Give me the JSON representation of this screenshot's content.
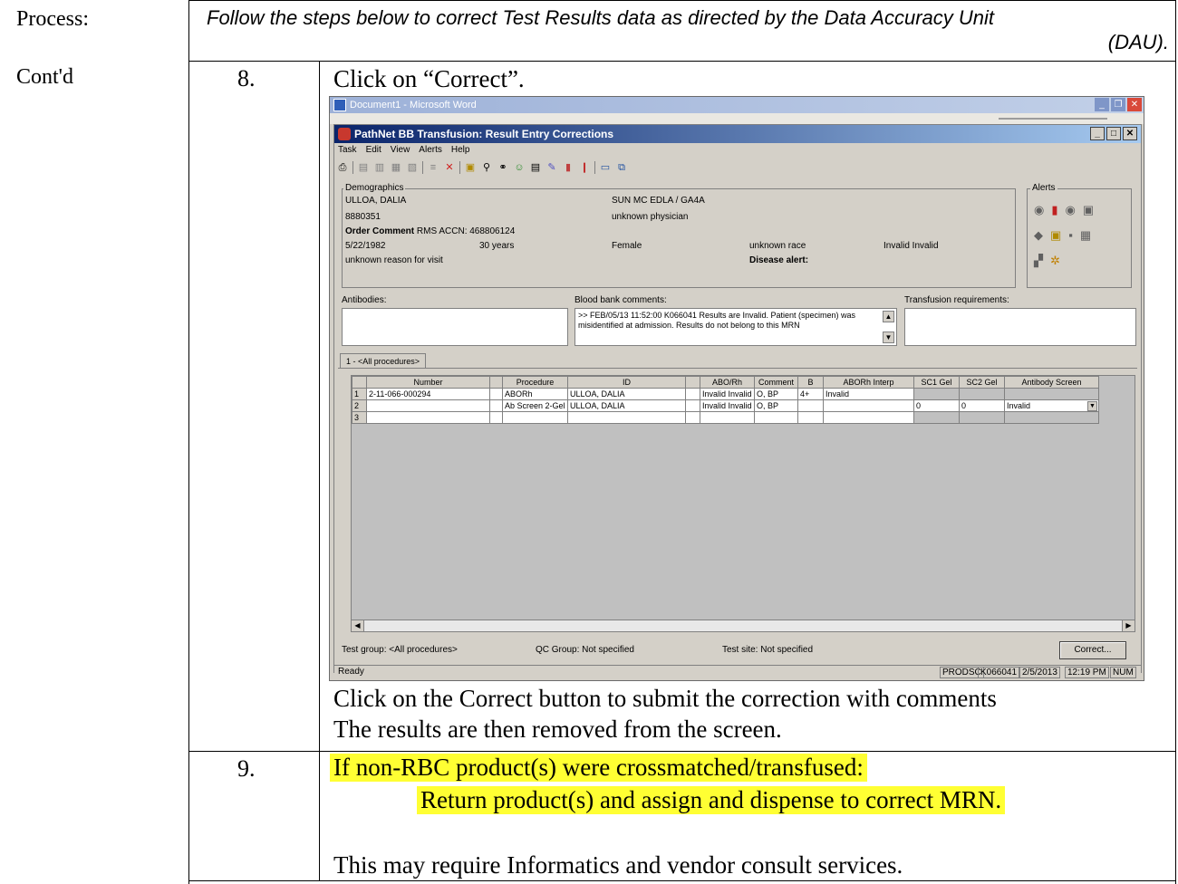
{
  "left_labels": {
    "process": "Process:",
    "contd": "Cont'd"
  },
  "header": {
    "line1": "Follow the steps below to correct Test Results data as directed by the Data Accuracy Unit",
    "line2": "(DAU)."
  },
  "step8": {
    "number": "8.",
    "instruction": "Click on “Correct”.",
    "after_line1": "Click on the Correct button to submit the correction with comments",
    "after_line2": "The results are then removed from the screen."
  },
  "step9": {
    "number": "9.",
    "line1": "If non-RBC product(s) were crossmatched/transfused:",
    "line2": "Return product(s) and assign and dispense to correct MRN.",
    "line3": "This may require Informatics and vendor consult services."
  },
  "screenshot": {
    "outer_title": "Document1 - Microsoft Word",
    "inner_title": "PathNet BB Transfusion: Result Entry Corrections",
    "menu": [
      "Task",
      "Edit",
      "View",
      "Alerts",
      "Help"
    ],
    "demographics": {
      "legend": "Demographics",
      "name": "ULLOA, DALIA",
      "facility": "SUN MC EDLA / GA4A",
      "mrn": "8880351",
      "physician": "unknown physician",
      "order_comment_label": "Order Comment",
      "order_comment_value": "RMS ACCN: 468806124",
      "dob": "5/22/1982",
      "age": "30 years",
      "sex": "Female",
      "race": "unknown race",
      "abo": "Invalid Invalid",
      "reason": "unknown reason for visit",
      "disease_alert": "Disease alert:"
    },
    "alerts_legend": "Alerts",
    "antibodies_label": "Antibodies:",
    "bb_comments_label": "Blood bank comments:",
    "bb_comments_text": ">> FEB/05/13 11:52:00  K066041   Results are Invalid.  Patient (specimen) was misidentified at admission.  Results do not belong to this MRN",
    "transfusion_label": "Transfusion requirements:",
    "tab_label": "1 - <All procedures>",
    "grid": {
      "columns": [
        "Number",
        "Procedure",
        "ID",
        "ABO/Rh",
        "Comment",
        "B",
        "ABORh Interp",
        "SC1 Gel",
        "SC2 Gel",
        "Antibody Screen"
      ],
      "rows": [
        {
          "n": "1",
          "number": "2-11-066-000294",
          "procedure": "ABORh",
          "id": "ULLOA, DALIA",
          "abo": "Invalid Invalid",
          "comment": "O, BP",
          "b": "4+",
          "interp": "Invalid",
          "sc1": "",
          "sc2": "",
          "ab": ""
        },
        {
          "n": "2",
          "number": "",
          "procedure": "Ab Screen 2-Gel",
          "id": "ULLOA, DALIA",
          "abo": "Invalid Invalid",
          "comment": "O, BP",
          "b": "",
          "interp": "",
          "sc1": "0",
          "sc2": "0",
          "ab": "Invalid"
        },
        {
          "n": "3",
          "number": "",
          "procedure": "",
          "id": "",
          "abo": "",
          "comment": "",
          "b": "",
          "interp": "",
          "sc1": "",
          "sc2": "",
          "ab": ""
        }
      ]
    },
    "test_group": "Test group:  <All procedures>",
    "qc_group": "QC Group:  Not specified",
    "test_site": "Test site:  Not specified",
    "correct_button": "Correct...",
    "status": {
      "ready": "Ready",
      "db": "PRODSC",
      "user": "K066041",
      "date": "2/5/2013",
      "time": "12:19 PM",
      "num": "NUM"
    }
  }
}
